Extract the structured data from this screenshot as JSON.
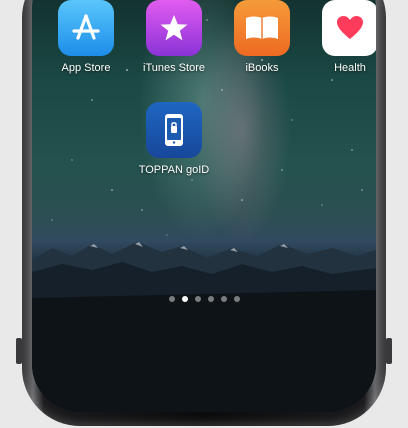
{
  "apps": [
    {
      "label": "App Store",
      "icon": "app-store-icon",
      "color": "#3aa0ee"
    },
    {
      "label": "iTunes Store",
      "icon": "itunes-store-icon",
      "color": "#b14adf"
    },
    {
      "label": "iBooks",
      "icon": "ibooks-icon",
      "color": "#f07a35"
    },
    {
      "label": "Health",
      "icon": "health-icon",
      "color": "#ffffff"
    },
    {
      "label": "TOPPAN goID",
      "icon": "toppan-goid-icon",
      "color": "#1d5bb0"
    }
  ],
  "page_indicator": {
    "total": 6,
    "active_index": 1
  }
}
